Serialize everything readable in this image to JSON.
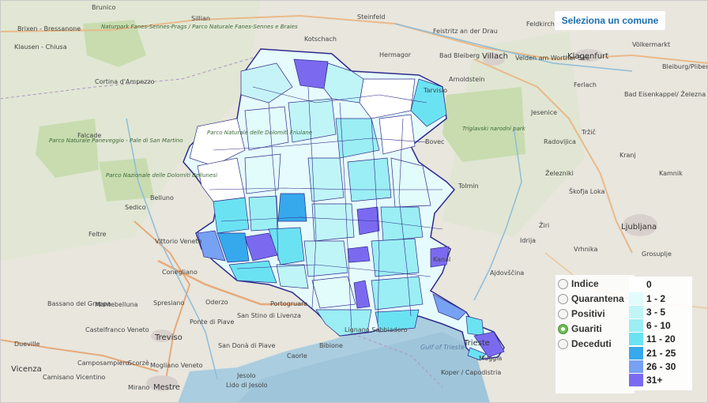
{
  "panel": {
    "title": "Seleziona un comune"
  },
  "options": [
    {
      "label": "Indice",
      "selected": false
    },
    {
      "label": "Quarantena",
      "selected": false
    },
    {
      "label": "Positivi",
      "selected": false
    },
    {
      "label": "Guariti",
      "selected": true
    },
    {
      "label": "Deceduti",
      "selected": false
    }
  ],
  "legend": [
    {
      "label": "0",
      "color": "#ffffff"
    },
    {
      "label": "1 - 2",
      "color": "#e2fbfb"
    },
    {
      "label": "3 - 5",
      "color": "#bff5f7"
    },
    {
      "label": "6 - 10",
      "color": "#9beef4"
    },
    {
      "label": "11 - 20",
      "color": "#6be2f2"
    },
    {
      "label": "21 - 25",
      "color": "#36a9ec"
    },
    {
      "label": "26 - 30",
      "color": "#77a1f2"
    },
    {
      "label": "31+",
      "color": "#7b6af0"
    }
  ],
  "places": {
    "brunico": "Brunico",
    "brixen": "Brixen - Bressanone",
    "klausen": "Klausen - Chiusa",
    "sillian": "Sillian",
    "steinfeld": "Steinfeld",
    "kotschach": "Kotschach",
    "hermagor": "Hermagor",
    "feistritz": "Feistritz an der Drau",
    "bad_bleiberg": "Bad Bleiberg",
    "villach": "Villach",
    "velden": "Velden am Worther See",
    "klagenfurt": "Klagenfurt",
    "feldkirchen": "Feldkirchen in Kärnten",
    "volkermarkt": "Völkermarkt",
    "bleiburg": "Bleiburg/Pliberk",
    "ferlach": "Ferlach",
    "arnoldstein": "Arnoldstein",
    "eisenkappel": "Bad Eisenkappel/ Železna Kapla",
    "jesenice": "Jesenice",
    "bovec": "Bovec",
    "radovljica": "Radovljica",
    "trzic": "Tržič",
    "zelezniki": "Železniki",
    "kamnik": "Kamnik",
    "skofja": "Škofja Loka",
    "kranj": "Kranj",
    "tolmin": "Tolmin",
    "ziri": "Žiri",
    "idrija": "Idrija",
    "ljubljana": "Ljubljana",
    "vrhnika": "Vrhnika",
    "grosuplje": "Grosuplje",
    "ajdovscina": "Ajdovščina",
    "kanal": "Kanal",
    "koper": "Koper / Capodistria",
    "cortina": "Cortina d'Ampezzo",
    "falcade": "Falcade",
    "sedico": "Sedico",
    "belluno": "Belluno",
    "feltre": "Feltre",
    "vittorio": "Vittorio Veneto",
    "conegliano": "Conegliano",
    "bassano": "Bassano del Grappa",
    "montebelluna": "Montebelluna",
    "castelfranco": "Castelfranco Veneto",
    "spresiano": "Spresiano",
    "oderzo": "Oderzo",
    "treviso": "Treviso",
    "ponte_piave": "Ponte di Piave",
    "san_stino": "San Stino di Livenza",
    "portogruaro": "Portogruaro",
    "san_dona": "San Donà di Piave",
    "caorle": "Caorle",
    "bibione": "Bibione",
    "lignano": "Lignano Sabbiadoro",
    "jesolo": "Jesolo",
    "lido_jesolo": "Lido di Jesolo",
    "mestre": "Mestre",
    "mirano": "Mirano",
    "mogliano": "Mogliano Veneto",
    "campo": "Camposampiero",
    "scorze": "Scorzè",
    "vicenza": "Vicenza",
    "camisano": "Camisano Vicentino",
    "dueville": "Dueville",
    "trieste": "Trieste",
    "muggia": "Muggia",
    "tarvisio": "Tarvisio",
    "gulf": "Gulf of Trieste",
    "dolomiti_friulane": "Parco Naturale delle Dolomiti Friulane",
    "fanes": "Naturpark Fanes-Sennes-Prags / Parco Naturale Fanes-Sennes e Braies",
    "paneveggio": "Parco Naturale Paneveggio - Pale di San Martino",
    "dolomiti_bellunesi": "Parco Nazionale delle Dolomiti Bellunesi",
    "triglav": "Triglavski narodni park"
  }
}
